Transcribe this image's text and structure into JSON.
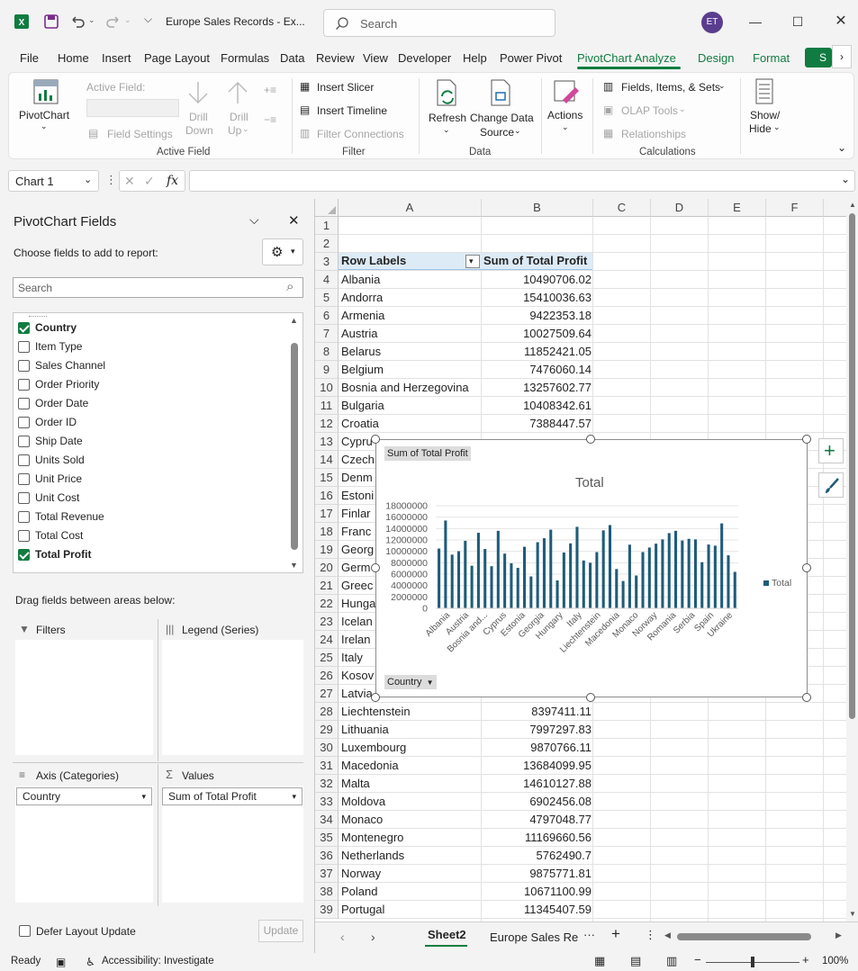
{
  "titlebar": {
    "title": "Europe Sales Records  -  Ex...",
    "search_placeholder": "Search",
    "avatar_initials": "ET"
  },
  "menu": {
    "tabs": [
      "File",
      "Home",
      "Insert",
      "Page Layout",
      "Formulas",
      "Data",
      "Review",
      "View",
      "Developer",
      "Help",
      "Power Pivot",
      "PivotChart Analyze",
      "Design",
      "Format"
    ],
    "active": "PivotChart Analyze",
    "share_label": "S"
  },
  "ribbon": {
    "pivotchart": "PivotChart",
    "active_field": "Active Field:",
    "field_settings": "Field Settings",
    "drill_down_1": "Drill",
    "drill_down_2": "Down",
    "drill_up_1": "Drill",
    "drill_up_2": "Up",
    "group_active_field": "Active Field",
    "insert_slicer": "Insert Slicer",
    "insert_timeline": "Insert Timeline",
    "filter_connections": "Filter Connections",
    "group_filter": "Filter",
    "refresh": "Refresh",
    "change_data_1": "Change Data",
    "change_data_2": "Source",
    "group_data": "Data",
    "actions": "Actions",
    "fields_items_sets": "Fields, Items, & Sets",
    "olap_tools": "OLAP Tools",
    "relationships": "Relationships",
    "group_calculations": "Calculations",
    "show_hide_1": "Show/",
    "show_hide_2": "Hide"
  },
  "formula_bar": {
    "name_box": "Chart 1",
    "fx": "fx",
    "formula": ""
  },
  "pivot_pane": {
    "title": "PivotChart Fields",
    "subtitle": "Choose fields to add to report:",
    "search_placeholder": "Search",
    "fields": [
      {
        "label": "Country",
        "checked": true
      },
      {
        "label": "Item Type",
        "checked": false
      },
      {
        "label": "Sales Channel",
        "checked": false
      },
      {
        "label": "Order Priority",
        "checked": false
      },
      {
        "label": "Order Date",
        "checked": false
      },
      {
        "label": "Order ID",
        "checked": false
      },
      {
        "label": "Ship Date",
        "checked": false
      },
      {
        "label": "Units Sold",
        "checked": false
      },
      {
        "label": "Unit Price",
        "checked": false
      },
      {
        "label": "Unit Cost",
        "checked": false
      },
      {
        "label": "Total Revenue",
        "checked": false
      },
      {
        "label": "Total Cost",
        "checked": false
      },
      {
        "label": "Total Profit",
        "checked": true
      }
    ],
    "drag_label": "Drag fields between areas below:",
    "filters_title": "Filters",
    "legend_title": "Legend (Series)",
    "axis_title": "Axis (Categories)",
    "values_title": "Values",
    "axis_field": "Country",
    "values_field": "Sum of Total Profit",
    "defer_label": "Defer Layout Update",
    "update_label": "Update"
  },
  "sheet": {
    "columns": [
      "A",
      "B",
      "C",
      "D",
      "E",
      "F"
    ],
    "row_numbers": [
      "1",
      "2",
      "3",
      "4",
      "5",
      "6",
      "7",
      "8",
      "9",
      "10",
      "11",
      "12",
      "13",
      "14",
      "15",
      "16",
      "17",
      "18",
      "19",
      "20",
      "21",
      "22",
      "23",
      "24",
      "25",
      "26",
      "27",
      "28",
      "29",
      "30",
      "31",
      "32",
      "33",
      "34",
      "35",
      "36",
      "37",
      "38",
      "39"
    ],
    "header_a": "Row Labels",
    "header_b": "Sum of Total Profit",
    "rows": [
      {
        "label": "Albania",
        "value": "10490706.02"
      },
      {
        "label": "Andorra",
        "value": "15410036.63"
      },
      {
        "label": "Armenia",
        "value": "9422353.18"
      },
      {
        "label": "Austria",
        "value": "10027509.64"
      },
      {
        "label": "Belarus",
        "value": "11852421.05"
      },
      {
        "label": "Belgium",
        "value": "7476060.14"
      },
      {
        "label": "Bosnia and Herzegovina",
        "value": "13257602.77"
      },
      {
        "label": "Bulgaria",
        "value": "10408342.61"
      },
      {
        "label": "Croatia",
        "value": "7388447.57"
      },
      {
        "label": "Cypru",
        "value": ""
      },
      {
        "label": "Czech",
        "value": ""
      },
      {
        "label": "Denm",
        "value": ""
      },
      {
        "label": "Estoni",
        "value": ""
      },
      {
        "label": "Finlar",
        "value": ""
      },
      {
        "label": "Franc",
        "value": ""
      },
      {
        "label": "Georg",
        "value": ""
      },
      {
        "label": "Germ",
        "value": ""
      },
      {
        "label": "Greec",
        "value": ""
      },
      {
        "label": "Hunga",
        "value": ""
      },
      {
        "label": "Icelan",
        "value": ""
      },
      {
        "label": "Irelan",
        "value": ""
      },
      {
        "label": "Italy",
        "value": ""
      },
      {
        "label": "Kosov",
        "value": ""
      },
      {
        "label": "Latvia",
        "value": ""
      },
      {
        "label": "Liechtenstein",
        "value": "8397411.11"
      },
      {
        "label": "Lithuania",
        "value": "7997297.83"
      },
      {
        "label": "Luxembourg",
        "value": "9870766.11"
      },
      {
        "label": "Macedonia",
        "value": "13684099.95"
      },
      {
        "label": "Malta",
        "value": "14610127.88"
      },
      {
        "label": "Moldova",
        "value": "6902456.08"
      },
      {
        "label": "Monaco",
        "value": "4797048.77"
      },
      {
        "label": "Montenegro",
        "value": "11169660.56"
      },
      {
        "label": "Netherlands",
        "value": "5762490.7"
      },
      {
        "label": "Norway",
        "value": "9875771.81"
      },
      {
        "label": "Poland",
        "value": "10671100.99"
      },
      {
        "label": "Portugal",
        "value": "11345407.59"
      }
    ]
  },
  "chart_data": {
    "type": "bar",
    "title": "Total",
    "field_button": "Sum of Total Profit",
    "axis_button": "Country",
    "legend": "Total",
    "legend_position": "right",
    "ylim": [
      0,
      18000000
    ],
    "yticks": [
      "18000000",
      "16000000",
      "14000000",
      "12000000",
      "10000000",
      "8000000",
      "6000000",
      "4000000",
      "2000000",
      "0"
    ],
    "x_tick_labels": [
      "Albania",
      "Austria",
      "Bosnia and...",
      "Cyprus",
      "Estonia",
      "Georgia",
      "Hungary",
      "Italy",
      "Liechtenstein",
      "Macedonia",
      "Monaco",
      "Norway",
      "Romania",
      "Serbia",
      "Spain",
      "Ukraine"
    ],
    "values": [
      10490706,
      15410037,
      9422353,
      10027510,
      11852421,
      7476060,
      13257603,
      10408343,
      7388448,
      13600000,
      9600000,
      7900000,
      7100000,
      10800000,
      5600000,
      11600000,
      12300000,
      13800000,
      4900000,
      9800000,
      11400000,
      14300000,
      8400000,
      7998000,
      9870766,
      13684100,
      14610128,
      6902456,
      4797049,
      11169661,
      5762491,
      9875772,
      10671101,
      11345408,
      12100000,
      13200000,
      13600000,
      11900000,
      12200000,
      12100000,
      8100000,
      11200000,
      11000000,
      14900000,
      9300000,
      6400000
    ],
    "bar_color": "#1f5c7a",
    "grid": true
  },
  "tabs": {
    "sheets": [
      "Sheet2",
      "Europe Sales Re"
    ],
    "active": "Sheet2"
  },
  "status": {
    "ready": "Ready",
    "accessibility": "Accessibility: Investigate",
    "zoom": "100%"
  }
}
